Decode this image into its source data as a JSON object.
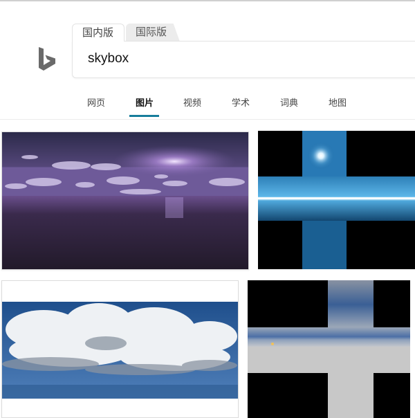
{
  "tabs": {
    "domestic": "国内版",
    "international": "国际版"
  },
  "search": {
    "query": "skybox"
  },
  "nav": {
    "items": [
      {
        "label": "网页"
      },
      {
        "label": "图片"
      },
      {
        "label": "视频"
      },
      {
        "label": "学术"
      },
      {
        "label": "词典"
      },
      {
        "label": "地图"
      }
    ],
    "active_index": 1
  },
  "colors": {
    "accent": "#177d9b",
    "logo": "#6a6a6a"
  },
  "results": [
    {
      "description": "purple-night-ocean-skybox"
    },
    {
      "description": "blue-cross-cubemap-skybox"
    },
    {
      "description": "cloudy-sky-panorama"
    },
    {
      "description": "grey-cross-cubemap-skybox"
    }
  ]
}
